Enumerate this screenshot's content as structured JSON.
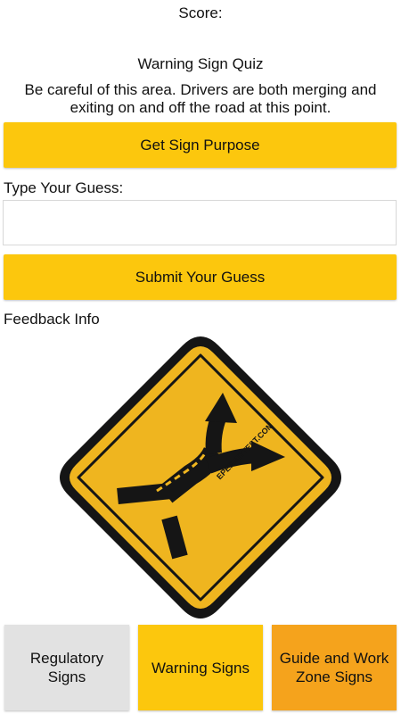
{
  "header": {
    "score_label": "Score:"
  },
  "quiz": {
    "title": "Warning Sign Quiz",
    "description": "Be careful of this area. Drivers are both merging and exiting on and off the road at this point.",
    "purpose_button": "Get Sign Purpose",
    "guess_label": "Type Your Guess:",
    "guess_value": "",
    "submit_button": "Submit Your Guess",
    "feedback_label": "Feedback Info"
  },
  "sign": {
    "icon": "merge-exit-warning-sign-icon",
    "watermark": "EPERMITTEST.COM",
    "colors": {
      "background": "#efb51f",
      "border": "#151515",
      "symbol": "#151515"
    }
  },
  "categories": [
    {
      "label": "Regulatory Signs",
      "color": "#e2e2e2"
    },
    {
      "label": "Warning Signs",
      "color": "#fcc70d"
    },
    {
      "label": "Guide and Work Zone Signs",
      "color": "#f5a31c"
    }
  ],
  "colors": {
    "button": "#fcc70d",
    "input_border": "#d8d8d8"
  }
}
